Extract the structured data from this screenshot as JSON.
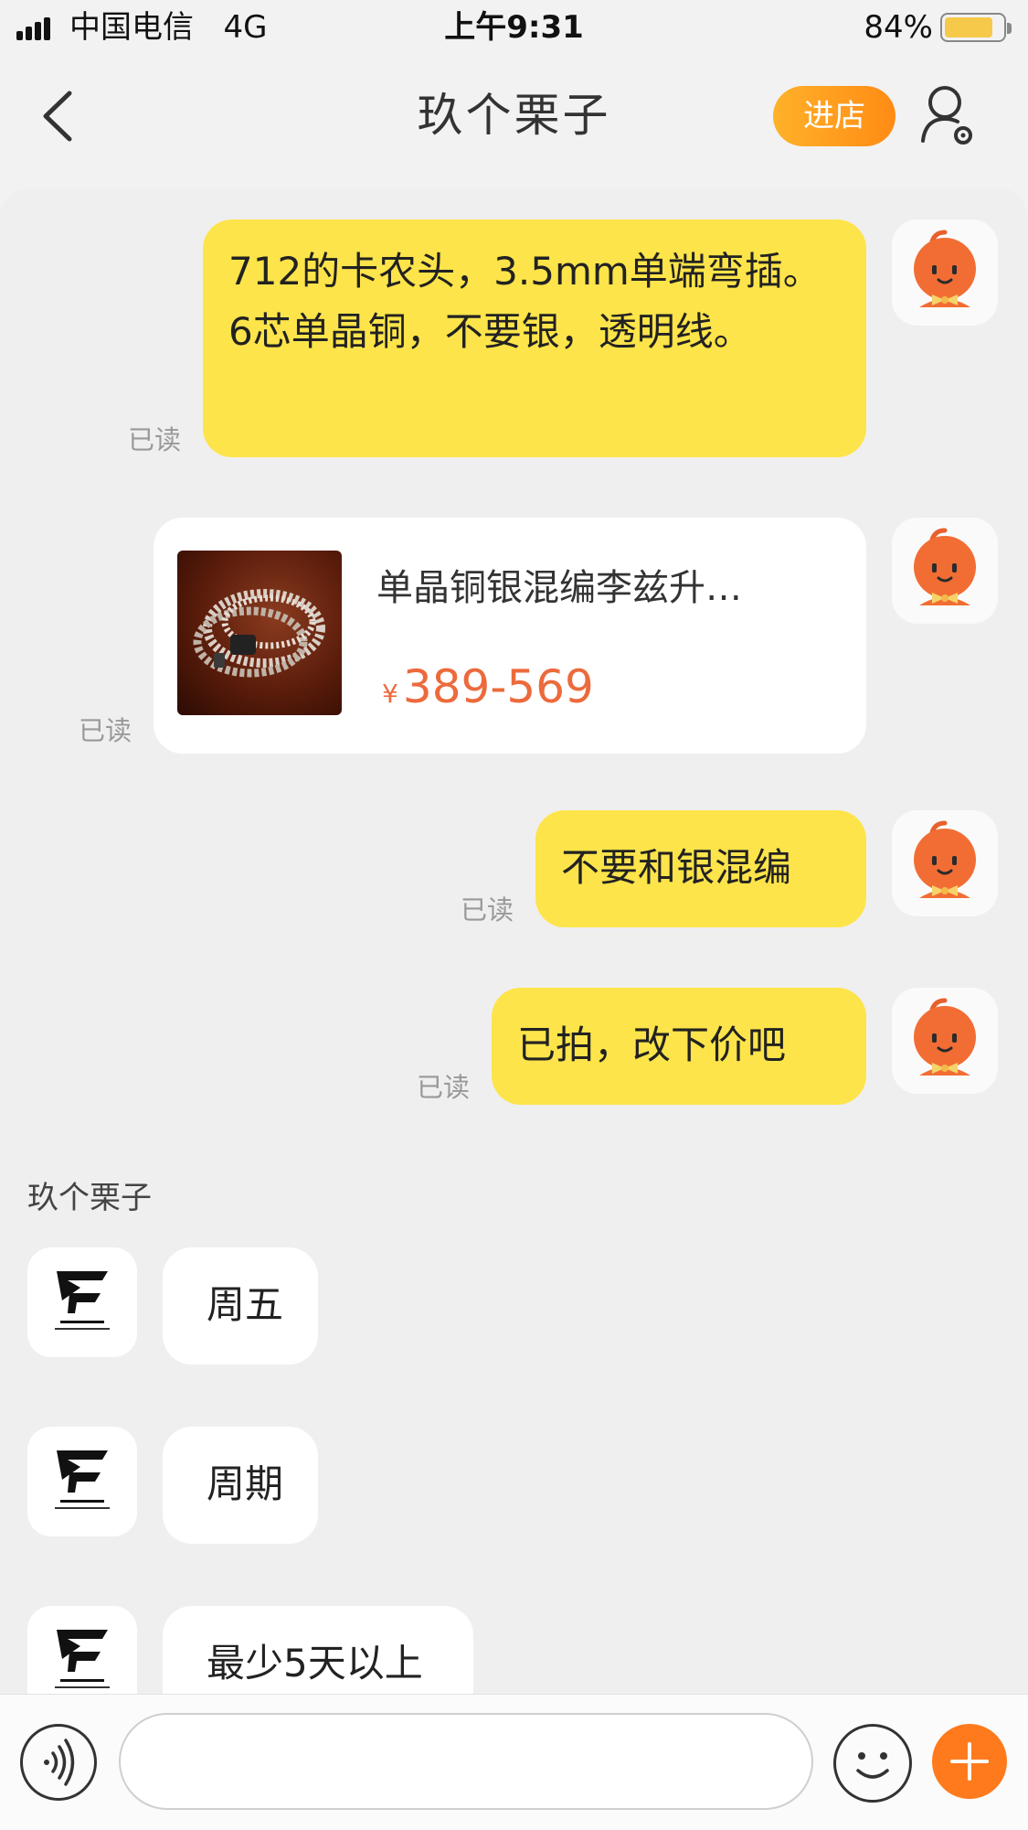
{
  "status_bar": {
    "carrier": "中国电信",
    "network": "4G",
    "time": "上午9:31",
    "battery": "84%",
    "battery_level": 0.84
  },
  "nav": {
    "title": "玖个栗子",
    "store_button": "进店"
  },
  "messages_sent": [
    {
      "text": "712的卡农头，3.5mm单端弯插。6芯单晶铜，不要银，透明线。",
      "status": "已读"
    },
    {
      "product_title": "单晶铜银混编李兹升…",
      "price_symbol": "¥",
      "price": "389-569",
      "status": "已读"
    },
    {
      "text": "不要和银混编",
      "status": "已读"
    },
    {
      "text": "已拍，改下价吧",
      "status": "已读"
    }
  ],
  "shop_sender_name": "玖个栗子",
  "messages_received": [
    {
      "text": "周五"
    },
    {
      "text": "周期"
    },
    {
      "text": "最少5天以上"
    }
  ],
  "colors": {
    "own_bubble": "#fde44a",
    "accent_orange": "#ff7a1c",
    "price": "#ec6a3c"
  },
  "icons": [
    "back-icon",
    "user-settings-icon",
    "pumpkin-avatar-icon",
    "audio-shop-logo-icon",
    "voice-icon",
    "emoji-icon",
    "plus-icon"
  ]
}
